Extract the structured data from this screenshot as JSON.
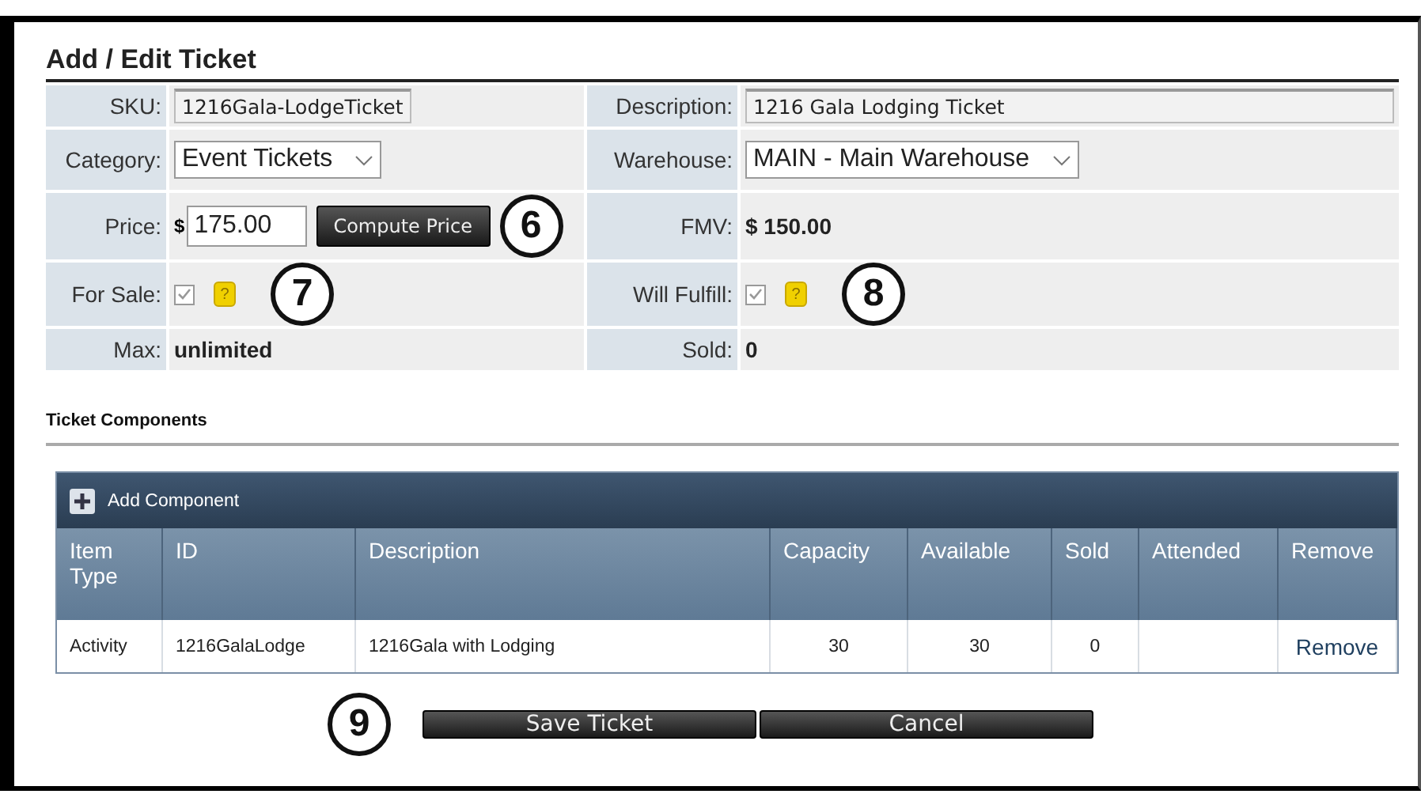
{
  "title": "Add / Edit Ticket",
  "form": {
    "rows": [
      {
        "left": {
          "label": "SKU:",
          "kind": "readonly",
          "value": "1216Gala-LodgeTicket"
        },
        "right": {
          "label": "Description:",
          "kind": "readonly",
          "value": "1216 Gala Lodging Ticket"
        }
      },
      {
        "left": {
          "label": "Category:",
          "kind": "select",
          "value": "Event Tickets"
        },
        "right": {
          "label": "Warehouse:",
          "kind": "select",
          "value": "MAIN - Main Warehouse"
        }
      },
      {
        "left": {
          "label": "Price:",
          "kind": "price",
          "prefix": "$",
          "value": "175.00",
          "button": "Compute Price",
          "callout": "6"
        },
        "right": {
          "label": "FMV:",
          "kind": "text",
          "value": "$ 150.00"
        }
      },
      {
        "left": {
          "label": "For Sale:",
          "kind": "checkbox",
          "checked": true,
          "help": "?",
          "callout": "7"
        },
        "right": {
          "label": "Will Fulfill:",
          "kind": "checkbox",
          "checked": true,
          "help": "?",
          "callout": "8"
        }
      },
      {
        "left": {
          "label": "Max:",
          "kind": "text",
          "value": "unlimited"
        },
        "right": {
          "label": "Sold:",
          "kind": "text",
          "value": "0"
        }
      }
    ]
  },
  "components": {
    "heading": "Ticket Components",
    "add_button": "Add Component",
    "columns": [
      "Item Type",
      "ID",
      "Description",
      "Capacity",
      "Available",
      "Sold",
      "Attended",
      "Remove"
    ],
    "rows": [
      {
        "cells": [
          "Activity",
          "1216GalaLodge",
          "1216Gala with Lodging",
          "30",
          "30",
          "0"
        ],
        "action": "Remove"
      }
    ]
  },
  "buttons": [
    {
      "label": "Save Ticket",
      "callout": "9"
    },
    {
      "label": "Cancel"
    }
  ]
}
